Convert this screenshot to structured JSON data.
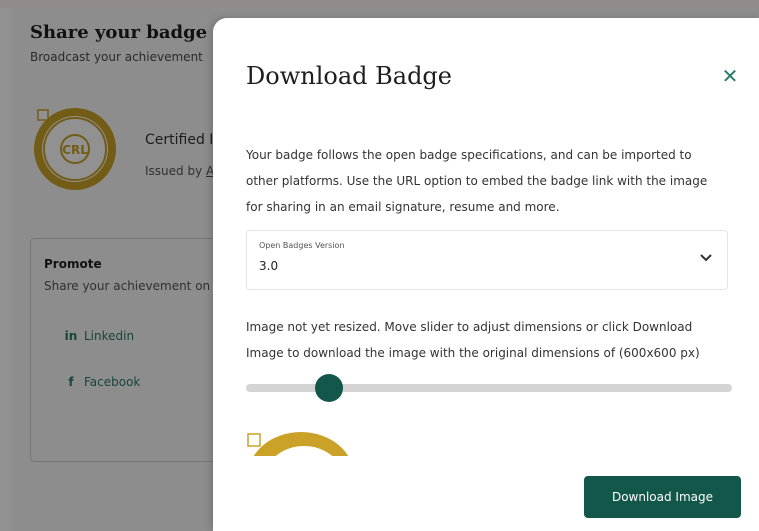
{
  "background": {
    "title": "Share your badge",
    "subtitle": "Broadcast your achievement",
    "certificate_title": "Certified I",
    "issued_by_prefix": "Issued by ",
    "issued_by_link": "A",
    "badge_text": "CRL",
    "promote": {
      "title": "Promote",
      "subtitle": "Share your achievement on",
      "items": [
        {
          "icon": "in",
          "label": "Linkedin"
        },
        {
          "icon": "f",
          "label": "Facebook"
        }
      ]
    }
  },
  "modal": {
    "title": "Download Badge",
    "close_symbol": "✕",
    "description": "Your badge follows the open badge specifications, and can be imported to other platforms. Use the URL option to embed the badge link with the image for sharing in an email signature, resume and more.",
    "version_select": {
      "label": "Open Badges Version",
      "value": "3.0"
    },
    "resize_text": "Image not yet resized. Move slider to adjust dimensions or click Download Image to download the image with the original dimensions of (600x600 px)",
    "slider": {
      "value_fraction": 0.17
    },
    "download_button": "Download Image"
  },
  "colors": {
    "accent": "#12574a",
    "badge_gold": "#c9a227",
    "overlay": "rgba(0,0,0,0.43)"
  }
}
